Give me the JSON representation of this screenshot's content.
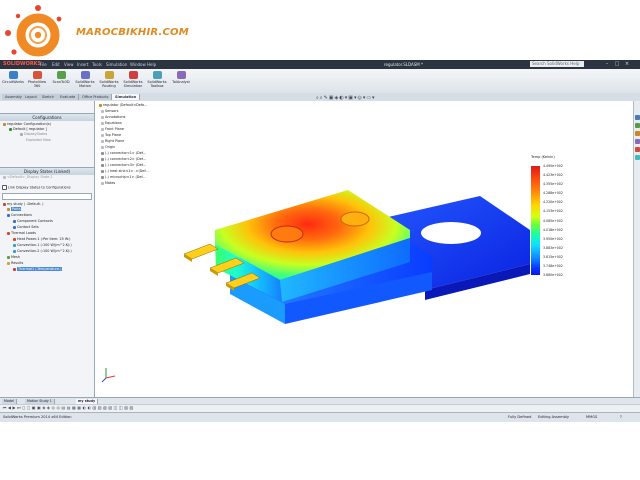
{
  "logo": {
    "text": "MAROCBIKHIR.COM"
  },
  "titlebar": {
    "brand": "SOLIDWORKS",
    "menus": [
      "File",
      "Edit",
      "View",
      "Insert",
      "Tools",
      "Simulation",
      "Window",
      "Help"
    ],
    "filename": "regulator.SLDASM *",
    "search_placeholder": "Search SolidWorks Help"
  },
  "commands": [
    {
      "label": "CircuitWorks",
      "color": "#3a7fc9"
    },
    {
      "label": "PhotoView 360",
      "color": "#d4553a"
    },
    {
      "label": "ScanTo3D",
      "color": "#5aa048"
    },
    {
      "label": "SolidWorks Motion",
      "color": "#6a6fc8"
    },
    {
      "label": "SolidWorks Routing",
      "color": "#c9a43a"
    },
    {
      "label": "SolidWorks Simulation",
      "color": "#d03f3f"
    },
    {
      "label": "SolidWorks Toolbox",
      "color": "#4b9fb8"
    },
    {
      "label": "TolAnalyst",
      "color": "#8a6ab8"
    }
  ],
  "tabs": [
    "Assembly",
    "Layout",
    "Sketch",
    "Evaluate",
    "Office Products",
    "Simulation"
  ],
  "left_panel": {
    "configurations_header": "Configurations",
    "config_tree": [
      "regulator Configuration(s)",
      "Default [ regulator ]",
      "DisplayStates",
      "Exploded View"
    ],
    "display_states_header": "Display States (Linked)",
    "display_state_item": "<Default>_Display State-1",
    "link_checkbox": "Link Display States to Configurations",
    "study_tree": [
      "my study ( -Default- )",
      "Parts",
      "Connections",
      "Component Contacts",
      "Contact Sets",
      "Thermal Loads",
      "Heat Power-1 (:Per item: 25 W:)",
      "Convection-1 (:100 W/(m^2.K):)",
      "Convection-2 (:100 W/(m^2.K):)",
      "Mesh",
      "Results",
      "Thermal1 (-Temperature-)"
    ]
  },
  "feature_tree": [
    "regulator (Default<Defa...",
    "Sensors",
    "Annotations",
    "Equations",
    "Front Plane",
    "Top Plane",
    "Right Plane",
    "Origin",
    "(-) connector<1> (Def...",
    "(-) connector<2> (Def...",
    "(-) connector<3> (Def...",
    "(-) heat sink<1> ->(Def...",
    "(-) microchip<1> (Def...",
    "Mates"
  ],
  "legend": {
    "title": "Temp (Kelvin)",
    "values": [
      "4.490e+002",
      "4.423e+002",
      "4.355e+002",
      "4.288e+002",
      "4.220e+002",
      "4.153e+002",
      "4.085e+002",
      "4.018e+002",
      "3.950e+002",
      "3.883e+002",
      "3.815e+002",
      "3.748e+002",
      "3.680e+002"
    ]
  },
  "bottom_tabs": [
    "Model",
    "Motion Study 1",
    "my study"
  ],
  "status": {
    "edition": "SolidWorks Premium 2014 x64 Edition",
    "defined": "Fully Defined",
    "mode": "Editing Assembly",
    "units": "MMGS",
    "help": "?"
  }
}
